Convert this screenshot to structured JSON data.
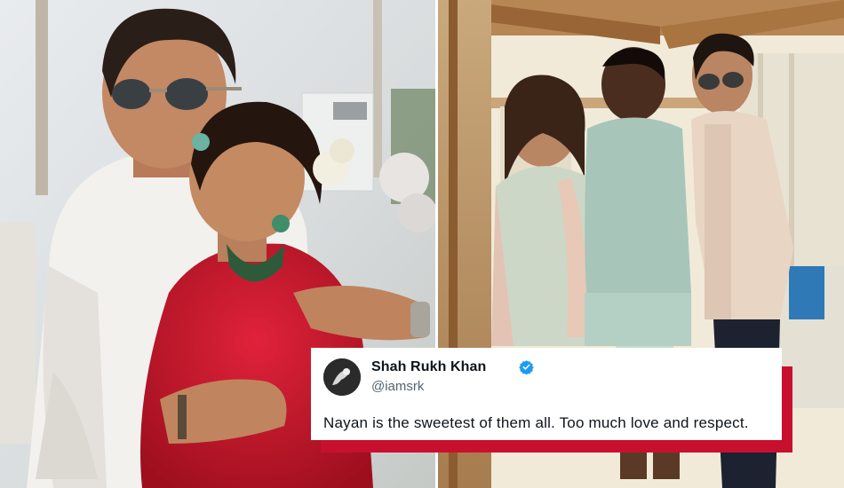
{
  "tweet": {
    "name": "Shah Rukh Khan",
    "handle": "@iamsrk",
    "text": "Nayan is the sweetest of them all. Too much love and respect.",
    "verified_icon": "verified-badge-icon",
    "avatar_icon": "profile-avatar"
  },
  "colors": {
    "accent_red": "#c8102e",
    "verified_blue": "#1d9bf0"
  }
}
